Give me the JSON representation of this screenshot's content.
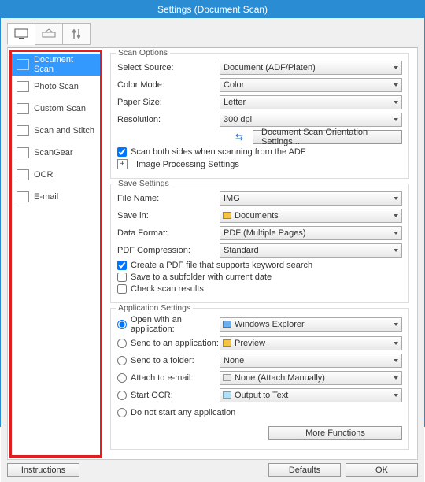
{
  "title": "Settings (Document Scan)",
  "sidebar": {
    "items": [
      {
        "label": "Document Scan"
      },
      {
        "label": "Photo Scan"
      },
      {
        "label": "Custom Scan"
      },
      {
        "label": "Scan and Stitch"
      },
      {
        "label": "ScanGear"
      },
      {
        "label": "OCR"
      },
      {
        "label": "E-mail"
      }
    ]
  },
  "scan": {
    "section": "Scan Options",
    "source_label": "Select Source:",
    "source_value": "Document (ADF/Platen)",
    "colormode_label": "Color Mode:",
    "colormode_value": "Color",
    "papersize_label": "Paper Size:",
    "papersize_value": "Letter",
    "resolution_label": "Resolution:",
    "resolution_value": "300 dpi",
    "orientation_btn": "Document Scan Orientation Settings...",
    "bothsides": "Scan both sides when scanning from the ADF",
    "imgproc": "Image Processing Settings"
  },
  "save": {
    "section": "Save Settings",
    "filename_label": "File Name:",
    "filename_value": "IMG",
    "savein_label": "Save in:",
    "savein_value": "Documents",
    "dataformat_label": "Data Format:",
    "dataformat_value": "PDF (Multiple Pages)",
    "pdfcomp_label": "PDF Compression:",
    "pdfcomp_value": "Standard",
    "keyword": "Create a PDF file that supports keyword search",
    "subfolder": "Save to a subfolder with current date",
    "checkresults": "Check scan results"
  },
  "app": {
    "section": "Application Settings",
    "openwith_label": "Open with an application:",
    "openwith_value": "Windows Explorer",
    "sendapp_label": "Send to an application:",
    "sendapp_value": "Preview",
    "sendfolder_label": "Send to a folder:",
    "sendfolder_value": "None",
    "attach_label": "Attach to e-mail:",
    "attach_value": "None (Attach Manually)",
    "ocr_label": "Start OCR:",
    "ocr_value": "Output to Text",
    "donot": "Do not start any application",
    "morefn": "More Functions"
  },
  "footer": {
    "instructions": "Instructions",
    "defaults": "Defaults",
    "ok": "OK"
  }
}
